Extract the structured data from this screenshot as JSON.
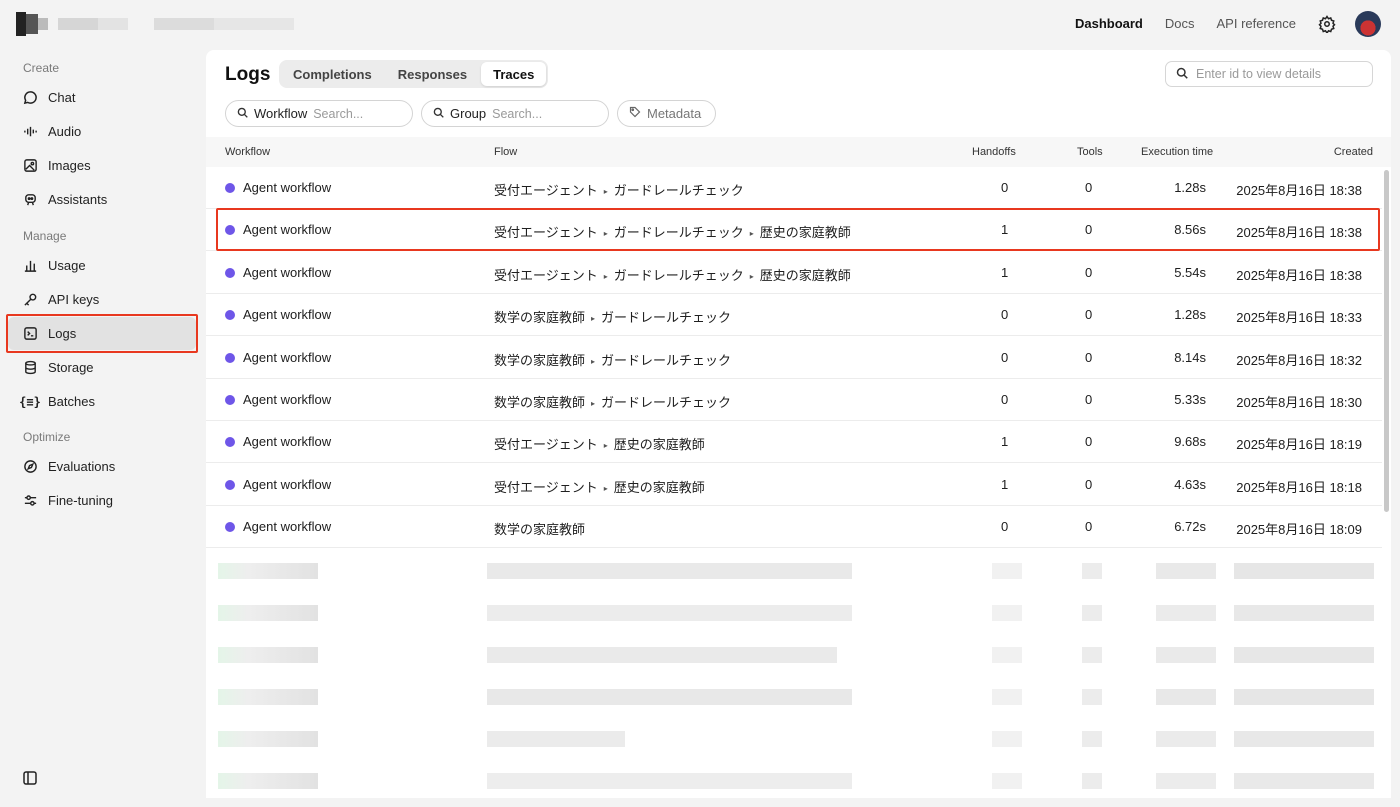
{
  "topnav": {
    "dashboard": "Dashboard",
    "docs": "Docs",
    "api_reference": "API reference"
  },
  "sidebar": {
    "sections": {
      "create": "Create",
      "manage": "Manage",
      "optimize": "Optimize"
    },
    "items": [
      {
        "label": "Chat",
        "icon": "chat-bubble-icon"
      },
      {
        "label": "Audio",
        "icon": "audio-wave-icon"
      },
      {
        "label": "Images",
        "icon": "image-icon"
      },
      {
        "label": "Assistants",
        "icon": "robot-icon"
      },
      {
        "label": "Usage",
        "icon": "bar-chart-icon"
      },
      {
        "label": "API keys",
        "icon": "key-icon"
      },
      {
        "label": "Logs",
        "icon": "terminal-icon"
      },
      {
        "label": "Storage",
        "icon": "database-icon"
      },
      {
        "label": "Batches",
        "icon": "braces-icon"
      },
      {
        "label": "Evaluations",
        "icon": "compass-icon"
      },
      {
        "label": "Fine-tuning",
        "icon": "sliders-icon"
      }
    ]
  },
  "main": {
    "title": "Logs",
    "tabs": [
      "Completions",
      "Responses",
      "Traces"
    ],
    "active_tab": "Traces",
    "id_search_placeholder": "Enter id to view details",
    "filters": {
      "workflow_label": "Workflow",
      "workflow_placeholder": "Search...",
      "group_label": "Group",
      "group_placeholder": "Search...",
      "metadata_label": "Metadata"
    },
    "table": {
      "columns": [
        "Workflow",
        "Flow",
        "Handoffs",
        "Tools",
        "Execution time",
        "Created"
      ],
      "flow_separator": "▸",
      "rows": [
        {
          "workflow": "Agent workflow",
          "flow": [
            "受付エージェント",
            "ガードレールチェック"
          ],
          "handoffs": "0",
          "tools": "0",
          "time": "1.28s",
          "created": "2025年8月16日 18:38"
        },
        {
          "workflow": "Agent workflow",
          "flow": [
            "受付エージェント",
            "ガードレールチェック",
            "歴史の家庭教師"
          ],
          "handoffs": "1",
          "tools": "0",
          "time": "8.56s",
          "created": "2025年8月16日 18:38"
        },
        {
          "workflow": "Agent workflow",
          "flow": [
            "受付エージェント",
            "ガードレールチェック",
            "歴史の家庭教師"
          ],
          "handoffs": "1",
          "tools": "0",
          "time": "5.54s",
          "created": "2025年8月16日 18:38"
        },
        {
          "workflow": "Agent workflow",
          "flow": [
            "数学の家庭教師",
            "ガードレールチェック"
          ],
          "handoffs": "0",
          "tools": "0",
          "time": "1.28s",
          "created": "2025年8月16日 18:33"
        },
        {
          "workflow": "Agent workflow",
          "flow": [
            "数学の家庭教師",
            "ガードレールチェック"
          ],
          "handoffs": "0",
          "tools": "0",
          "time": "8.14s",
          "created": "2025年8月16日 18:32"
        },
        {
          "workflow": "Agent workflow",
          "flow": [
            "数学の家庭教師",
            "ガードレールチェック"
          ],
          "handoffs": "0",
          "tools": "0",
          "time": "5.33s",
          "created": "2025年8月16日 18:30"
        },
        {
          "workflow": "Agent workflow",
          "flow": [
            "受付エージェント",
            "歴史の家庭教師"
          ],
          "handoffs": "1",
          "tools": "0",
          "time": "9.68s",
          "created": "2025年8月16日 18:19"
        },
        {
          "workflow": "Agent workflow",
          "flow": [
            "受付エージェント",
            "歴史の家庭教師"
          ],
          "handoffs": "1",
          "tools": "0",
          "time": "4.63s",
          "created": "2025年8月16日 18:18"
        },
        {
          "workflow": "Agent workflow",
          "flow": [
            "数学の家庭教師"
          ],
          "handoffs": "0",
          "tools": "0",
          "time": "6.72s",
          "created": "2025年8月16日 18:09"
        }
      ]
    }
  },
  "colors": {
    "status_dot": "#6e56e8",
    "highlight": "#e8381f"
  }
}
